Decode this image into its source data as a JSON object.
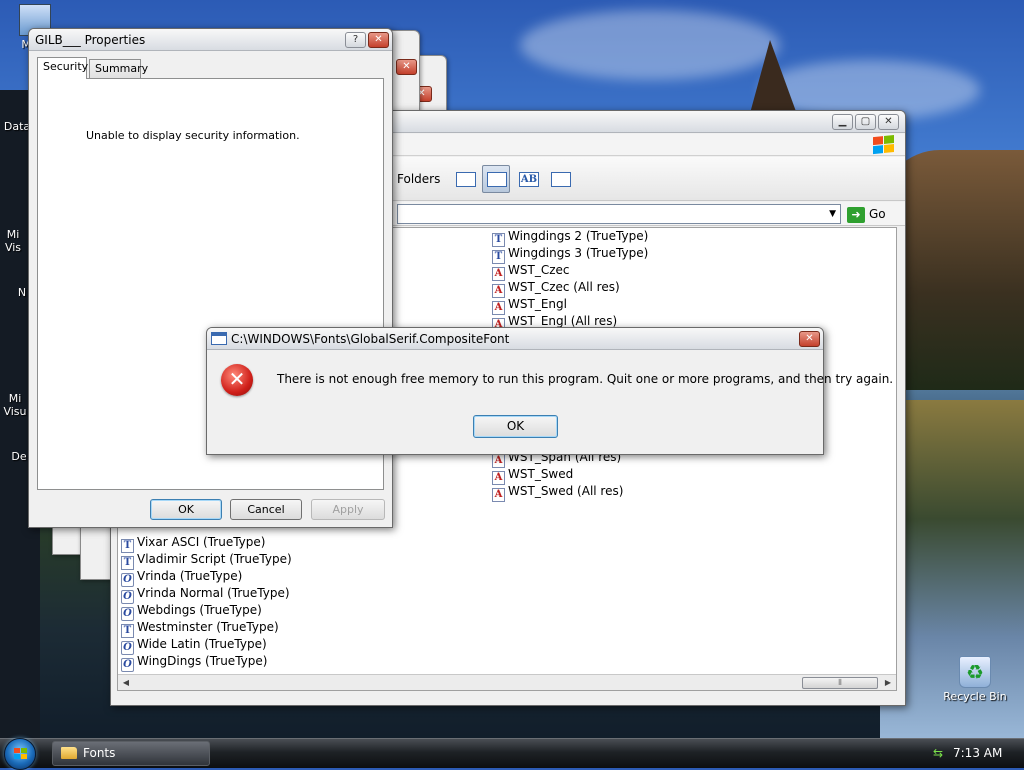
{
  "desktop": {
    "icons": [
      {
        "label": "My C"
      },
      {
        "label": "Data"
      },
      {
        "label": "Mi\nVis"
      },
      {
        "label": "N"
      },
      {
        "label": "Mi\nVisu"
      },
      {
        "label": "De"
      }
    ],
    "recycle_bin": {
      "label": "Recycle Bin",
      "icon": "recycle-bin-icon"
    }
  },
  "fonts_window": {
    "toolbar": {
      "folders_label": "Folders"
    },
    "address": {
      "go_label": "Go"
    },
    "right_column": [
      {
        "name": "Wingdings 2 (TrueType)",
        "type": "tt"
      },
      {
        "name": "Wingdings 3 (TrueType)",
        "type": "tt"
      },
      {
        "name": "WST_Czec",
        "type": "a"
      },
      {
        "name": "WST_Czec (All res)",
        "type": "a"
      },
      {
        "name": "WST_Engl",
        "type": "a"
      },
      {
        "name": "WST_Engl (All res)",
        "type": "a"
      }
    ],
    "right_column_lower": [
      {
        "name": "WST_Span (All res)",
        "type": "a"
      },
      {
        "name": "WST_Swed",
        "type": "a"
      },
      {
        "name": "WST_Swed (All res)",
        "type": "a"
      }
    ],
    "left_column": [
      {
        "name": "Vixar ASCI (TrueType)",
        "type": "tt"
      },
      {
        "name": "Vladimir Script (TrueType)",
        "type": "tt"
      },
      {
        "name": "Vrinda (TrueType)",
        "type": "o"
      },
      {
        "name": "Vrinda Normal (TrueType)",
        "type": "o"
      },
      {
        "name": "Webdings (TrueType)",
        "type": "o"
      },
      {
        "name": "Westminster (TrueType)",
        "type": "tt"
      },
      {
        "name": "Wide Latin (TrueType)",
        "type": "o"
      },
      {
        "name": "WingDings (TrueType)",
        "type": "o"
      }
    ]
  },
  "properties_window": {
    "title": "GILB___ Properties",
    "tabs": [
      {
        "label": "Security"
      },
      {
        "label": "Summary"
      }
    ],
    "message": "Unable to display security information.",
    "buttons": {
      "ok": "OK",
      "cancel": "Cancel",
      "apply": "Apply"
    }
  },
  "error_dialog": {
    "title": "C:\\WINDOWS\\Fonts\\GlobalSerif.CompositeFont",
    "message": "There is not enough free memory to run this program. Quit one or more programs, and then try again.",
    "ok_label": "OK"
  },
  "taskbar": {
    "task_label": "Fonts",
    "clock": "7:13 AM"
  },
  "colors": {
    "error_red": "#d0201a",
    "accent_blue": "#3c7fb1"
  }
}
